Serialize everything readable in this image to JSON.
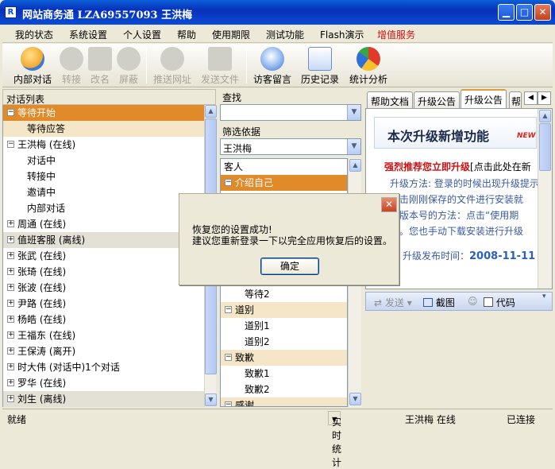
{
  "window": {
    "title": "网站商务通  LZA69557093 王洪梅",
    "app_icon": "R"
  },
  "menu": [
    "我的状态",
    "系统设置",
    "个人设置",
    "帮助",
    "使用期限",
    "测试功能",
    "Flash演示",
    "增值服务"
  ],
  "toolbar": [
    {
      "label": "内部对话",
      "icon": "people-icon",
      "enabled": true
    },
    {
      "label": "转接",
      "icon": "transfer-icon",
      "enabled": false
    },
    {
      "label": "改名",
      "icon": "rename-icon",
      "enabled": false
    },
    {
      "label": "屏蔽",
      "icon": "block-icon",
      "enabled": false
    },
    {
      "label": "推送网址",
      "icon": "globe-icon",
      "enabled": false
    },
    {
      "label": "发送文件",
      "icon": "send-file-icon",
      "enabled": false
    },
    {
      "label": "访客留言",
      "icon": "message-icon",
      "enabled": true
    },
    {
      "label": "历史记录",
      "icon": "history-icon",
      "enabled": true
    },
    {
      "label": "统计分析",
      "icon": "pie-chart-icon",
      "enabled": true
    }
  ],
  "left": {
    "header": "对话列表",
    "items": [
      {
        "text": "等待开始",
        "kind": "group",
        "pm": "−",
        "style": "sel"
      },
      {
        "text": "等待应答",
        "kind": "child",
        "style": "grp"
      },
      {
        "text": "王洪梅 (在线)",
        "kind": "group",
        "pm": "−",
        "style": ""
      },
      {
        "text": "对话中",
        "kind": "child",
        "style": ""
      },
      {
        "text": "转接中",
        "kind": "child",
        "style": ""
      },
      {
        "text": "邀请中",
        "kind": "child",
        "style": ""
      },
      {
        "text": "内部对话",
        "kind": "child",
        "style": ""
      },
      {
        "text": "周通 (在线)",
        "kind": "group",
        "pm": "+",
        "style": ""
      },
      {
        "text": "值班客服 (离线)",
        "kind": "group",
        "pm": "+",
        "style": "grey"
      },
      {
        "text": "张武 (在线)",
        "kind": "group",
        "pm": "+",
        "style": ""
      },
      {
        "text": "张琦 (在线)",
        "kind": "group",
        "pm": "+",
        "style": ""
      },
      {
        "text": "张波 (在线)",
        "kind": "group",
        "pm": "+",
        "style": ""
      },
      {
        "text": "尹路 (在线)",
        "kind": "group",
        "pm": "+",
        "style": ""
      },
      {
        "text": "杨皓 (在线)",
        "kind": "group",
        "pm": "+",
        "style": ""
      },
      {
        "text": "王福东 (在线)",
        "kind": "group",
        "pm": "+",
        "style": ""
      },
      {
        "text": "王保涛 (离开)",
        "kind": "group",
        "pm": "+",
        "style": ""
      },
      {
        "text": "时大伟 (对话中)1个对话",
        "kind": "group",
        "pm": "+",
        "style": ""
      },
      {
        "text": "罗华 (在线)",
        "kind": "group",
        "pm": "+",
        "style": ""
      },
      {
        "text": "刘生 (离线)",
        "kind": "group",
        "pm": "+",
        "style": "grey"
      }
    ]
  },
  "middle": {
    "find_label": "查找",
    "filter_label": "筛选依据",
    "filter_value": "王洪梅",
    "items": [
      {
        "text": "客人",
        "kind": "child0",
        "style": ""
      },
      {
        "text": "介绍自己",
        "kind": "group",
        "pm": "−",
        "style": "sel"
      },
      {
        "text": "",
        "kind": "child",
        "style": ""
      },
      {
        "text": "",
        "kind": "child",
        "style": ""
      },
      {
        "text": "",
        "kind": "child",
        "style": ""
      },
      {
        "text": "",
        "kind": "child",
        "style": ""
      },
      {
        "text": "",
        "kind": "child",
        "style": ""
      },
      {
        "text": "",
        "kind": "child",
        "style": ""
      },
      {
        "text": "等待2",
        "kind": "child",
        "style": ""
      },
      {
        "text": "道别",
        "kind": "group",
        "pm": "−",
        "style": "grp"
      },
      {
        "text": "道别1",
        "kind": "child",
        "style": ""
      },
      {
        "text": "道别2",
        "kind": "child",
        "style": ""
      },
      {
        "text": "致歉",
        "kind": "group",
        "pm": "−",
        "style": "grp"
      },
      {
        "text": "致歉1",
        "kind": "child",
        "style": ""
      },
      {
        "text": "致歉2",
        "kind": "child",
        "style": ""
      },
      {
        "text": "感谢",
        "kind": "group",
        "pm": "−",
        "style": "grp"
      }
    ]
  },
  "right": {
    "tabs": [
      "帮助文档",
      "升级公告",
      "升级公告",
      "帮"
    ],
    "doc": {
      "heading": "本次升级新增功能",
      "new_badge": "NEW",
      "recommend": "强烈推荐您立即升级",
      "recommend_tail": "[点击此处在新",
      "lines": [
        "升级方法: 登录的时候出现升级提示",
        "双击刚刚保存的文件进行安装就",
        "看版本号的方法：点击“使用期",
        "级。您也手动下载安装进行升级"
      ],
      "date_label": "升级发布时间：",
      "date": "2008-11-11"
    },
    "send_label": "发送",
    "screenshot_label": "截图",
    "code_label": "代码"
  },
  "dialog": {
    "message1": "恢复您的设置成功!",
    "message2": "建议您重新登录一下以完全应用恢复后的设置。",
    "ok": "确定",
    "close": "X"
  },
  "status": {
    "left": "就绪",
    "stats": "实时统计",
    "user": "王洪梅 在线",
    "conn": "已连接"
  }
}
